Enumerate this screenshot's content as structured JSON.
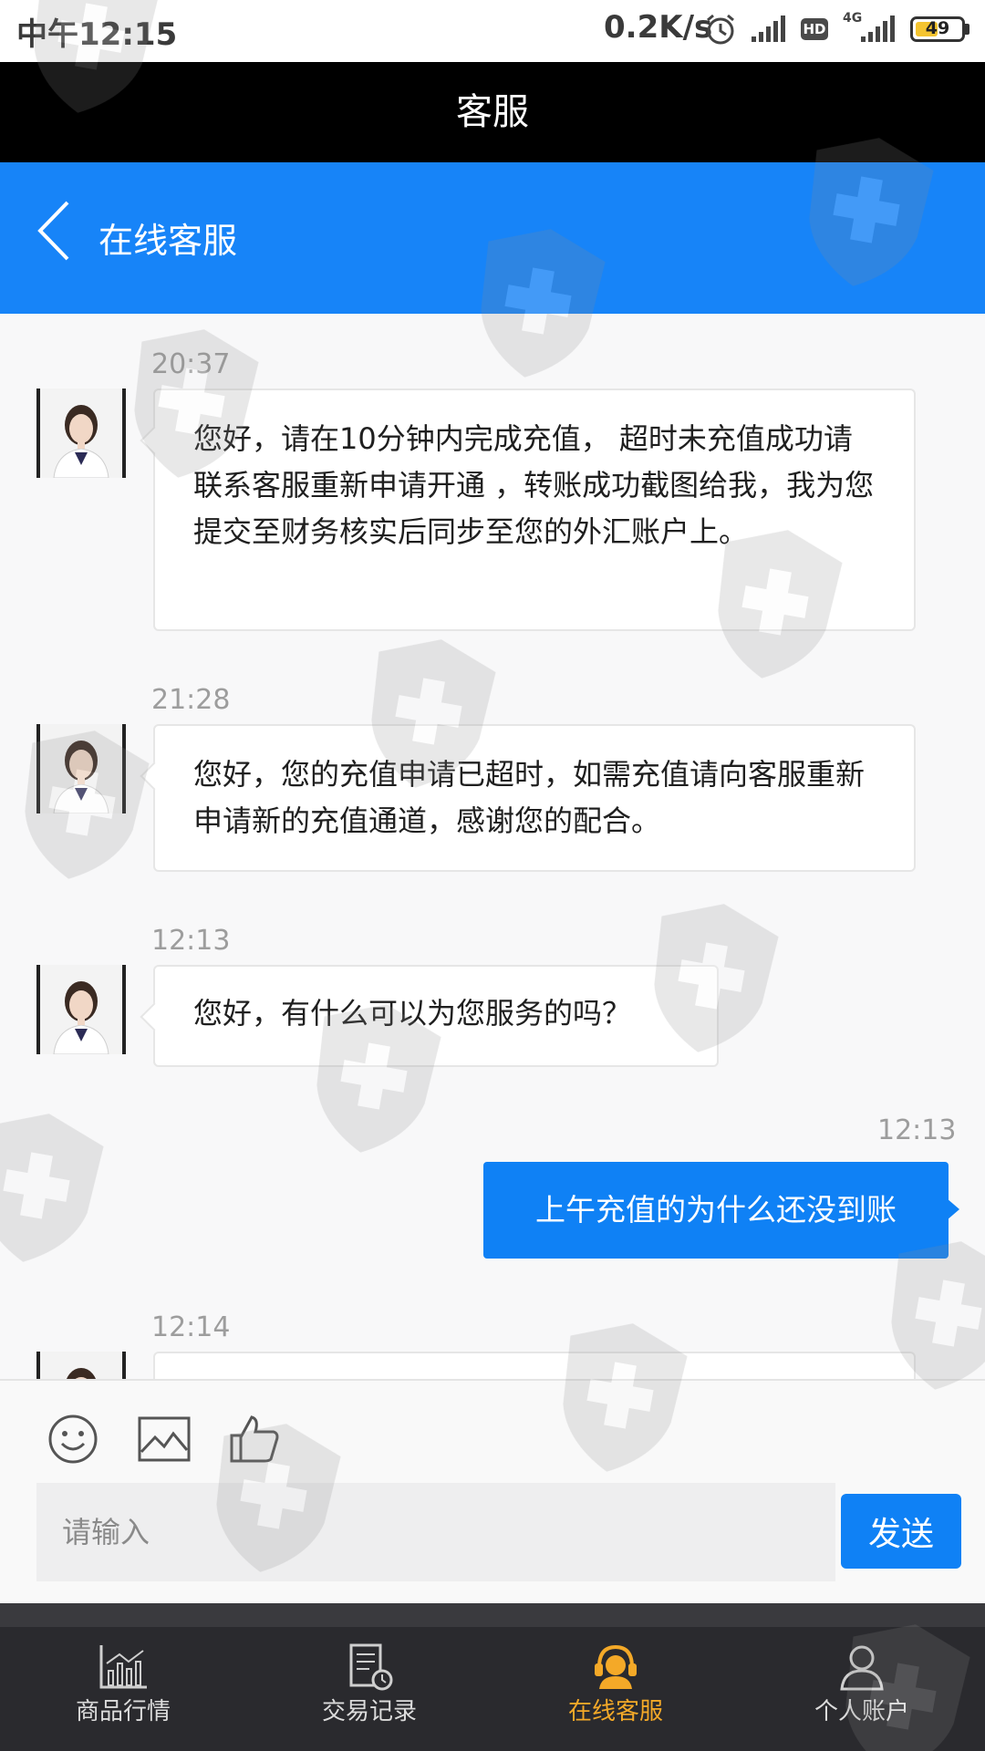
{
  "status_bar": {
    "time": "中午12:15",
    "network_speed": "0.2K/s",
    "hd_label": "HD",
    "network_type": "4G",
    "battery": "49",
    "battery_level": 0.49,
    "icons": [
      "alarm-icon",
      "signal-icon",
      "signal-icon"
    ]
  },
  "app_title": "客服",
  "header": {
    "back_icon": "chevron-left-icon",
    "title": "在线客服"
  },
  "messages": [
    {
      "time": "20:37",
      "direction": "in",
      "text": "您好，请在10分钟内完成充值， 超时未充值成功请联系客服重新申请开通 ，转账成功截图给我，我为您提交至财务核实后同步至您的外汇账户上。"
    },
    {
      "time": "21:28",
      "direction": "in",
      "text": "您好，您的充值申请已超时，如需充值请向客服重新申请新的充值通道，感谢您的配合。"
    },
    {
      "time": "12:13",
      "direction": "in",
      "text": "您好，有什么可以为您服务的吗？"
    },
    {
      "time": "12:13",
      "direction": "out",
      "text": "上午充值的为什么还没到账"
    },
    {
      "time": "12:14",
      "direction": "in",
      "text": ""
    }
  ],
  "toolbar": {
    "icons": [
      "emoji-icon",
      "image-icon",
      "thumbs-up-icon"
    ]
  },
  "input": {
    "placeholder": "请输入",
    "value": ""
  },
  "send_label": "发送",
  "nav": [
    {
      "label": "商品行情",
      "icon": "chart-icon",
      "active": false
    },
    {
      "label": "交易记录",
      "icon": "records-icon",
      "active": false
    },
    {
      "label": "在线客服",
      "icon": "customer-service-icon",
      "active": true
    },
    {
      "label": "个人账户",
      "icon": "user-icon",
      "active": false
    }
  ],
  "colors": {
    "header_blue": "#1784f8",
    "send_blue": "#0f81f5",
    "nav_background": "#2a2a2e",
    "nav_active": "#f4a928",
    "title_bar": "#000000"
  }
}
